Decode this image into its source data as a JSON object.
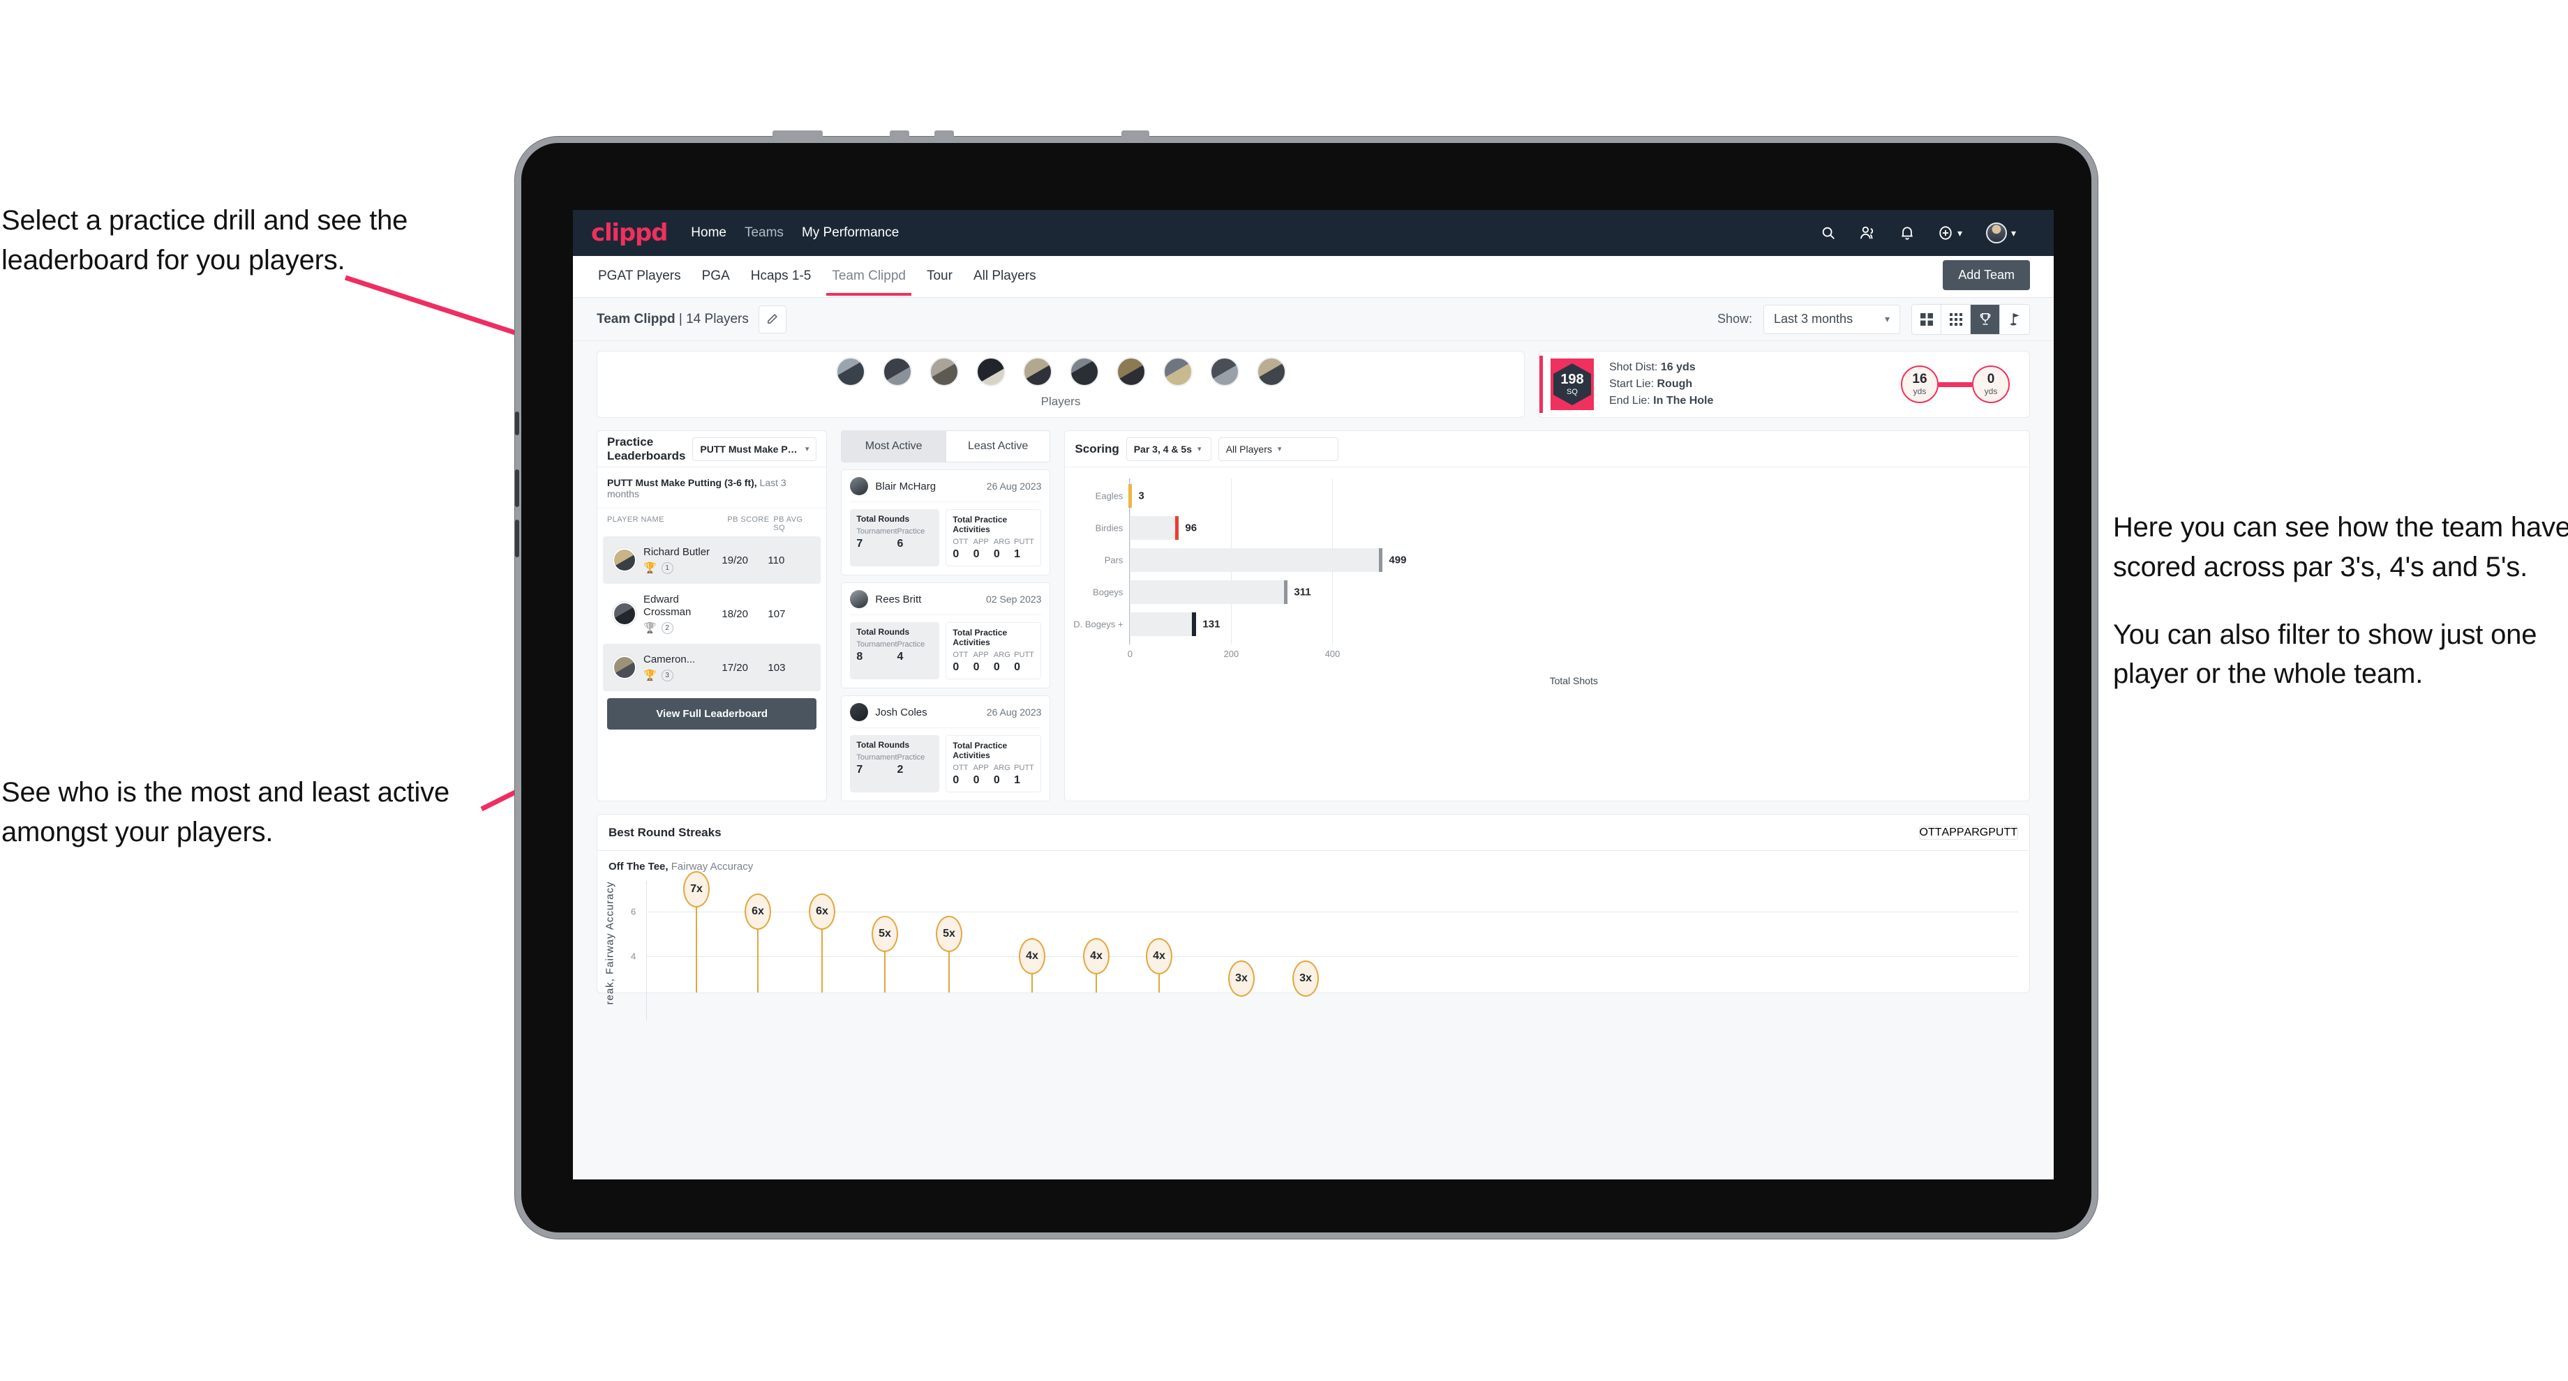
{
  "annotations": {
    "top_left": "Select a practice drill and see the leaderboard for you players.",
    "bottom_left": "See who is the most and least active amongst your players.",
    "right_1": "Here you can see how the team have scored across par 3's, 4's and 5's.",
    "right_2": "You can also filter to show just one player or the whole team."
  },
  "topbar": {
    "logo": "clippd",
    "links": [
      "Home",
      "Teams",
      "My Performance"
    ],
    "icons": [
      "search-icon",
      "people-icon",
      "bell-icon",
      "plus-circle-icon",
      "avatar"
    ]
  },
  "tabs": {
    "items": [
      "PGAT Players",
      "PGA",
      "Hcaps 1-5",
      "Team Clippd",
      "Tour",
      "All Players"
    ],
    "active": "Team Clippd",
    "add_team": "Add Team"
  },
  "subheader": {
    "team_name": "Team Clippd",
    "team_count": "14 Players",
    "separator": " | ",
    "show_label": "Show:",
    "period": "Last 3 months",
    "view_icons": [
      "grid-large-icon",
      "grid-small-icon",
      "trophy-icon",
      "flag-icon"
    ],
    "active_view": "trophy-icon"
  },
  "players_strip": {
    "label": "Players",
    "count": 10
  },
  "shot_card": {
    "sq_value": "198",
    "sq_unit": "SQ",
    "lines": [
      {
        "label": "Shot Dist:",
        "value": "16 yds"
      },
      {
        "label": "Start Lie:",
        "value": "Rough"
      },
      {
        "label": "End Lie:",
        "value": "In The Hole"
      }
    ],
    "start_dist": "16",
    "start_unit": "yds",
    "end_dist": "0",
    "end_unit": "yds"
  },
  "leaderboard": {
    "title": "Practice Leaderboards",
    "drill_select": "PUTT Must Make Putting ...",
    "subtitle_bold": "PUTT Must Make Putting (3-6 ft),",
    "subtitle_dim": " Last 3 months",
    "columns": [
      "PLAYER NAME",
      "PB SCORE",
      "PB AVG SQ"
    ],
    "rows": [
      {
        "name": "Richard Butler",
        "rank": "1",
        "score": "19/20",
        "avg_sq": "110",
        "medal": "gold"
      },
      {
        "name": "Edward Crossman",
        "rank": "2",
        "score": "18/20",
        "avg_sq": "107",
        "medal": "silver"
      },
      {
        "name": "Cameron...",
        "rank": "3",
        "score": "17/20",
        "avg_sq": "103",
        "medal": "bronze"
      }
    ],
    "button": "View Full Leaderboard"
  },
  "activity": {
    "tabs": [
      "Most Active",
      "Least Active"
    ],
    "active_tab": "Most Active",
    "rounds_title": "Total Rounds",
    "rounds_keys": [
      "Tournament",
      "Practice"
    ],
    "practice_title": "Total Practice Activities",
    "practice_keys": [
      "OTT",
      "APP",
      "ARG",
      "PUTT"
    ],
    "cards": [
      {
        "name": "Blair McHarg",
        "date": "26 Aug 2023",
        "tournament": "7",
        "practice": "6",
        "ott": "0",
        "app": "0",
        "arg": "0",
        "putt": "1"
      },
      {
        "name": "Rees Britt",
        "date": "02 Sep 2023",
        "tournament": "8",
        "practice": "4",
        "ott": "0",
        "app": "0",
        "arg": "0",
        "putt": "0"
      },
      {
        "name": "Josh Coles",
        "date": "26 Aug 2023",
        "tournament": "7",
        "practice": "2",
        "ott": "0",
        "app": "0",
        "arg": "0",
        "putt": "1"
      }
    ]
  },
  "scoring": {
    "title": "Scoring",
    "par_filter": "Par 3, 4 & 5s",
    "player_filter": "All Players"
  },
  "streaks": {
    "title": "Best Round Streaks",
    "segments": [
      "OTT",
      "APP",
      "ARG",
      "PUTT"
    ],
    "active_segment": "OTT",
    "sub_bold": "Off The Tee,",
    "sub_dim": " Fairway Accuracy",
    "y_axis_label": "reak, Fairway Accuracy",
    "y_ticks": [
      "6",
      "4"
    ]
  },
  "chart_data": [
    {
      "type": "bar",
      "orientation": "horizontal",
      "title": "Scoring",
      "categories": [
        "Eagles",
        "Birdies",
        "Pars",
        "Bogeys",
        "D. Bogeys +"
      ],
      "values": [
        3,
        96,
        499,
        311,
        131
      ],
      "cap_colors": [
        "#edb543",
        "#e8402f",
        "#8e959c",
        "#8e959c",
        "#1d2530"
      ],
      "xlabel": "Total Shots",
      "ylabel": "",
      "xticks": [
        0,
        200,
        400
      ],
      "xlim": [
        0,
        540
      ],
      "grid": true,
      "legend": "none"
    },
    {
      "type": "scatter",
      "title": "Best Round Streaks",
      "subtitle": "Off The Tee, Fairway Accuracy",
      "ylabel": "reak, Fairway Accuracy",
      "yticks": [
        6,
        4
      ],
      "ylim": [
        2.2,
        8.2
      ],
      "labels": [
        "7x",
        "6x",
        "6x",
        "5x",
        "5x",
        "4x",
        "4x",
        "4x",
        "3x",
        "3x"
      ],
      "values": [
        7,
        6,
        6,
        5,
        5,
        4,
        4,
        4,
        3,
        3
      ],
      "grid": true,
      "marker": "lollipop-bubble",
      "color": "#e2a73c"
    }
  ]
}
